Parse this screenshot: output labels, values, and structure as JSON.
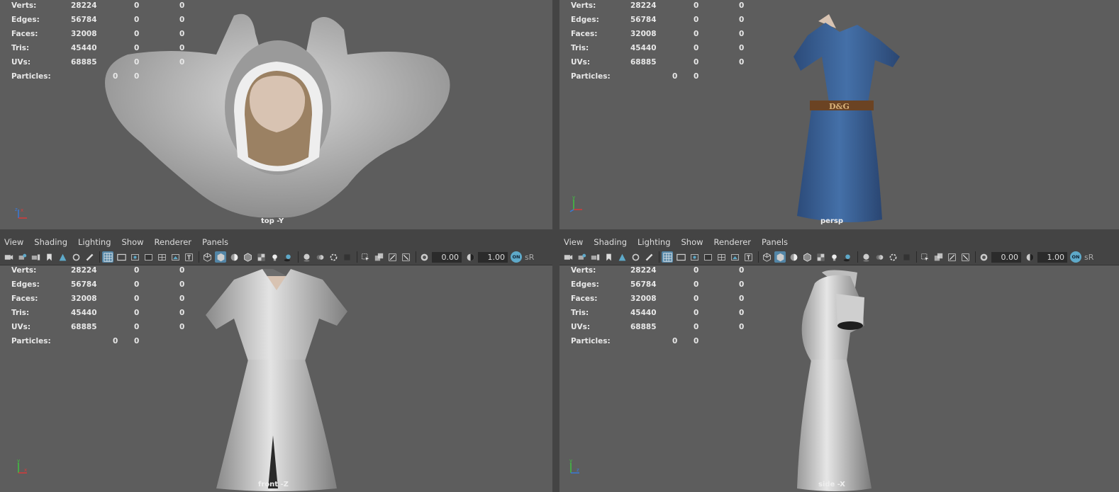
{
  "menu": [
    "View",
    "Shading",
    "Lighting",
    "Show",
    "Renderer",
    "Panels"
  ],
  "toolbar": {
    "field1": "0.00",
    "field2": "1.00",
    "on_badge": "ON",
    "srgb": "sR"
  },
  "hud_labels": {
    "verts": "Verts:",
    "edges": "Edges:",
    "faces": "Faces:",
    "tris": "Tris:",
    "uvs": "UVs:",
    "particles": "Particles:"
  },
  "hud_values": {
    "verts": [
      "28224",
      "0",
      "0"
    ],
    "edges": [
      "56784",
      "0",
      "0"
    ],
    "faces": [
      "32008",
      "0",
      "0"
    ],
    "tris": [
      "45440",
      "0",
      "0"
    ],
    "uvs": [
      "68885",
      "0",
      "0"
    ],
    "particles": [
      "0",
      "0"
    ]
  },
  "axis_labels": {
    "x": "x",
    "y": "y",
    "z": "z"
  },
  "viewports": {
    "top": {
      "camera": "top -Y"
    },
    "persp": {
      "camera": "persp",
      "belt_text": "D&G"
    },
    "front": {
      "camera": "front -Z"
    },
    "side": {
      "camera": "side -X"
    }
  },
  "colors": {
    "viewport_bg": "#5d5d5d",
    "panel_bg": "#444444",
    "active_icon": "#5285a6",
    "denim": "#3b5f93",
    "belt": "#6b4323",
    "skin": "#d8c3b2",
    "cloth_gray": "#c9c9c9"
  }
}
